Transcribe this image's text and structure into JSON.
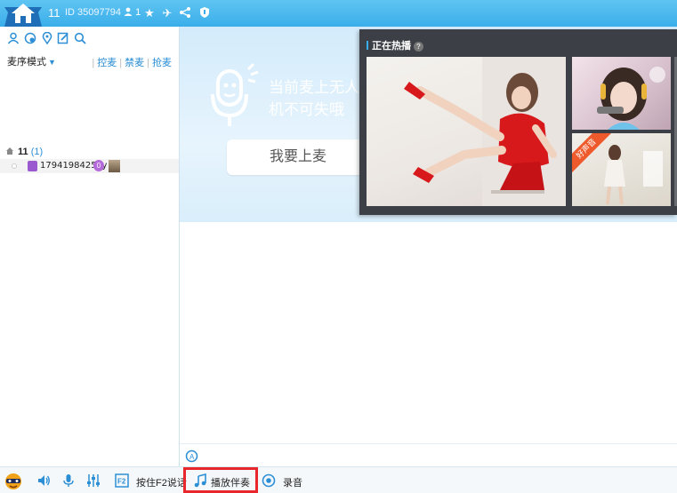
{
  "titlebar": {
    "room_num": "11",
    "room_id": "ID 35097794",
    "user_count": "1",
    "icons": [
      "home-logo-icon",
      "star-icon",
      "plane-icon",
      "share-icon",
      "shield-icon"
    ]
  },
  "left": {
    "tool_icons": [
      "user-icon",
      "chat-bubble-icon",
      "location-pin-icon",
      "edit-icon",
      "search-icon"
    ],
    "mode_label": "麦序模式",
    "mic_links": [
      "控麦",
      "禁麦",
      "抢麦"
    ],
    "channel": {
      "name": "11",
      "count": "(1)"
    },
    "user": {
      "name": "1794198425yy",
      "level": "0"
    }
  },
  "stage": {
    "tip": "当前麦上无人\n机不可失哦",
    "apply_label": "我要上麦"
  },
  "hot": {
    "title": "正在热播",
    "help": "?",
    "ribbon": "好声音"
  },
  "bottom": {
    "items": [
      {
        "icon": "speaker-icon"
      },
      {
        "icon": "microphone-icon"
      },
      {
        "icon": "equalizer-icon"
      },
      {
        "icon": "f2-key-icon",
        "label": "按住F2说话"
      },
      {
        "icon": "music-note-icon",
        "label": "播放伴奏"
      },
      {
        "icon": "record-icon",
        "label": "录音"
      }
    ]
  },
  "colors": {
    "accent": "#3aaeea",
    "highlight": "#e8262b",
    "popup": "#3c3f45"
  }
}
